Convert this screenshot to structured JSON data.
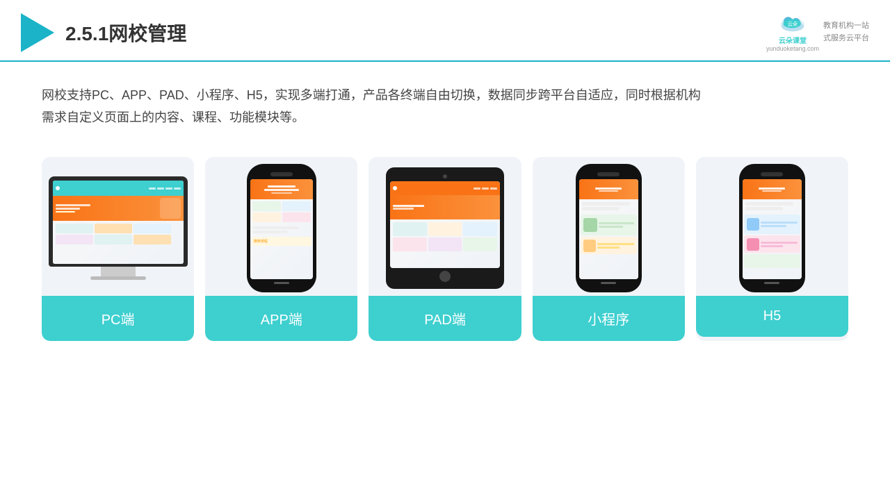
{
  "header": {
    "title": "2.5.1网校管理",
    "brand_name": "云朵课堂",
    "brand_url": "yunduoketang.com",
    "brand_tagline": "教育机构一站\n式服务云平台"
  },
  "description": {
    "text": "网校支持PC、APP、PAD、小程序、H5，实现多端打通，产品各终端自由切换，数据同步跨平台自适应，同时根据机构\n需求自定义页面上的内容、课程、功能模块等。"
  },
  "cards": [
    {
      "id": "pc",
      "label": "PC端"
    },
    {
      "id": "app",
      "label": "APP端"
    },
    {
      "id": "pad",
      "label": "PAD端"
    },
    {
      "id": "miniapp",
      "label": "小程序"
    },
    {
      "id": "h5",
      "label": "H5"
    }
  ]
}
